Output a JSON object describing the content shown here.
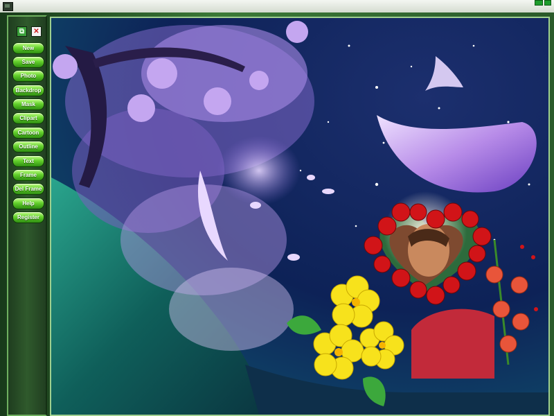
{
  "window": {
    "title": ""
  },
  "toolbar": {
    "top_icons": [
      {
        "name": "copy-icon",
        "glyph": "⧉"
      },
      {
        "name": "close-icon",
        "glyph": "✕"
      }
    ],
    "buttons": [
      "New",
      "Save",
      "Photo",
      "Backdrop",
      "Mask",
      "Clipart",
      "Cartoon",
      "Outline",
      "Text",
      "Frame",
      "Del Frame",
      "Help",
      "Register"
    ]
  },
  "canvas": {
    "backdrop": "night-sky-cherry-blossom",
    "frame": "heart-rose-frame",
    "clipart": [
      "yellow-flowers",
      "red-orange-flowers"
    ],
    "colors": {
      "sky": "#0b1f4f",
      "blossom": "#b79be6",
      "hill": "#1f7f74",
      "rose": "#d11418",
      "yellow_flower": "#f7e21c",
      "button_green": "#5ccc2a"
    }
  }
}
